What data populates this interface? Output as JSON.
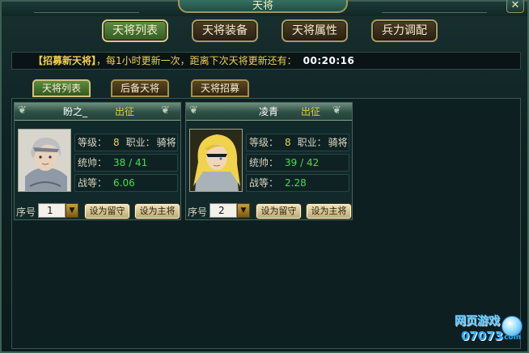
{
  "window": {
    "title": "天将",
    "close_label": "✕"
  },
  "top_tabs": [
    {
      "label": "天将列表",
      "active": true
    },
    {
      "label": "天将装备",
      "active": false
    },
    {
      "label": "天将属性",
      "active": false
    },
    {
      "label": "兵力调配",
      "active": false
    }
  ],
  "notice": {
    "bracket": "【招募新天将】",
    "text": "，每1小时更新一次，距离下次天将更新还有：",
    "countdown": "00:20:16"
  },
  "sub_tabs": [
    {
      "label": "天将列表",
      "active": true
    },
    {
      "label": "后备天将",
      "active": false
    },
    {
      "label": "天将招募",
      "active": false
    }
  ],
  "cards": [
    {
      "name": "盼之_",
      "status": "出征",
      "level_label": "等级：",
      "level": "8",
      "job_label": "职业：",
      "job": "骑将",
      "command_label": "统帅：",
      "command": "38 / 41",
      "battle_label": "战等：",
      "battle": "6.06",
      "seq_label": "序号",
      "seq": "1",
      "btn_keep": "设为留守",
      "btn_main": "设为主将"
    },
    {
      "name": "凌青",
      "status": "出征",
      "level_label": "等级：",
      "level": "8",
      "job_label": "职业：",
      "job": "骑将",
      "command_label": "统帅：",
      "command": "39 / 42",
      "battle_label": "战等：",
      "battle": "2.28",
      "seq_label": "序号",
      "seq": "2",
      "btn_keep": "设为留守",
      "btn_main": "设为主将"
    }
  ],
  "watermark": {
    "line1": "网页游戏",
    "line2": "07073",
    "line3": ".com"
  },
  "colors": {
    "accent_yellow": "#e9d34e",
    "accent_green": "#42e04a",
    "tab_active": "#5d8c3e",
    "tab_inactive": "#5b4622"
  }
}
